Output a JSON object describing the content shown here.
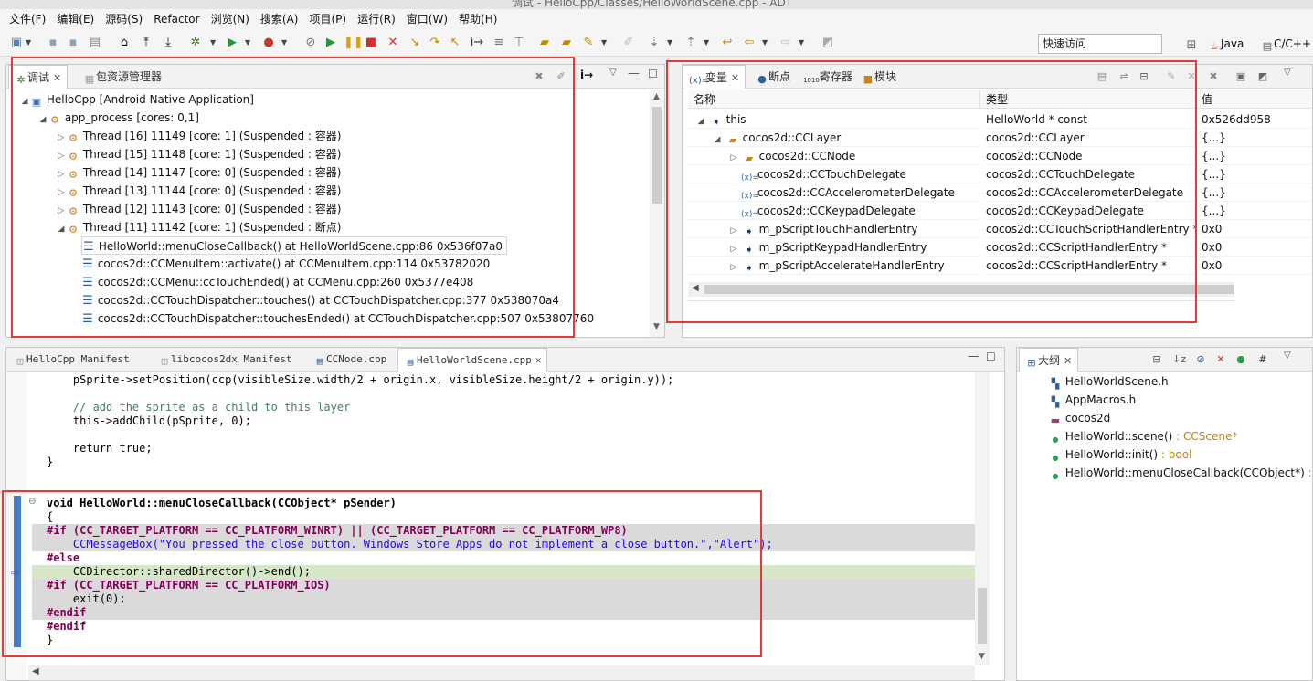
{
  "window": {
    "title": "调试 - HelloCpp/Classes/HelloWorldScene.cpp - ADT"
  },
  "menu": [
    "文件(F)",
    "编辑(E)",
    "源码(S)",
    "Refactor",
    "浏览(N)",
    "搜索(A)",
    "项目(P)",
    "运行(R)",
    "窗口(W)",
    "帮助(H)"
  ],
  "toolbar": {
    "quick_access": "快速访问",
    "persp_java": "Java",
    "persp_cpp": "C/C++"
  },
  "debug_panel": {
    "tabs": [
      "调试",
      "包资源管理器"
    ],
    "tree": [
      {
        "label": "HelloCpp [Android Native Application]"
      },
      {
        "label": "app_process [cores: 0,1]"
      },
      {
        "label": "Thread [16] 11149 [core: 1] (Suspended : 容器)"
      },
      {
        "label": "Thread [15] 11148 [core: 1] (Suspended : 容器)"
      },
      {
        "label": "Thread [14] 11147 [core: 0] (Suspended : 容器)"
      },
      {
        "label": "Thread [13] 11144 [core: 0] (Suspended : 容器)"
      },
      {
        "label": "Thread [12] 11143 [core: 0] (Suspended : 容器)"
      },
      {
        "label": "Thread [11] 11142 [core: 1] (Suspended : 断点)"
      },
      {
        "label": "HelloWorld::menuCloseCallback() at HelloWorldScene.cpp:86 0x536f07a0"
      },
      {
        "label": "cocos2d::CCMenuItem::activate() at CCMenuItem.cpp:114 0x53782020"
      },
      {
        "label": "cocos2d::CCMenu::ccTouchEnded() at CCMenu.cpp:260 0x5377e408"
      },
      {
        "label": "cocos2d::CCTouchDispatcher::touches() at CCTouchDispatcher.cpp:377 0x538070a4"
      },
      {
        "label": "cocos2d::CCTouchDispatcher::touchesEnded() at CCTouchDispatcher.cpp:507 0x53807760"
      }
    ]
  },
  "variables_panel": {
    "tabs": [
      "变量",
      "断点",
      "寄存器",
      "模块"
    ],
    "columns": [
      "名称",
      "类型",
      "值"
    ],
    "rows": [
      {
        "name": "this",
        "type": "HelloWorld * const",
        "value": "0x526dd958"
      },
      {
        "name": "cocos2d::CCLayer",
        "type": "cocos2d::CCLayer",
        "value": "{...}"
      },
      {
        "name": "cocos2d::CCNode",
        "type": "cocos2d::CCNode",
        "value": "{...}"
      },
      {
        "name": "cocos2d::CCTouchDelegate",
        "type": "cocos2d::CCTouchDelegate",
        "value": "{...}"
      },
      {
        "name": "cocos2d::CCAccelerometerDelegate",
        "type": "cocos2d::CCAccelerometerDelegate",
        "value": "{...}"
      },
      {
        "name": "cocos2d::CCKeypadDelegate",
        "type": "cocos2d::CCKeypadDelegate",
        "value": "{...}"
      },
      {
        "name": "m_pScriptTouchHandlerEntry",
        "type": "cocos2d::CCTouchScriptHandlerEntry *",
        "value": "0x0"
      },
      {
        "name": "m_pScriptKeypadHandlerEntry",
        "type": "cocos2d::CCScriptHandlerEntry *",
        "value": "0x0"
      },
      {
        "name": "m_pScriptAccelerateHandlerEntry",
        "type": "cocos2d::CCScriptHandlerEntry *",
        "value": "0x0"
      }
    ]
  },
  "editor": {
    "tabs": [
      "HelloCpp Manifest",
      "libcocos2dx Manifest",
      "CCNode.cpp",
      "HelloWorldScene.cpp"
    ],
    "lines": [
      "    pSprite->setPosition(ccp(visibleSize.width/2 + origin.x, visibleSize.height/2 + origin.y));",
      "",
      "    // add the sprite as a child to this layer",
      "    this->addChild(pSprite, 0);",
      "",
      "    return true;",
      "}",
      "",
      "",
      "void HelloWorld::menuCloseCallback(CCObject* pSender)",
      "{",
      "#if (CC_TARGET_PLATFORM == CC_PLATFORM_WINRT) || (CC_TARGET_PLATFORM == CC_PLATFORM_WP8)",
      "    CCMessageBox(\"You pressed the close button. Windows Store Apps do not implement a close button.\",\"Alert\");",
      "#else",
      "    CCDirector::sharedDirector()->end();",
      "#if (CC_TARGET_PLATFORM == CC_PLATFORM_IOS)",
      "    exit(0);",
      "#endif",
      "#endif",
      "}"
    ]
  },
  "outline_panel": {
    "tab": "大纲",
    "items": [
      {
        "name": "HelloWorldScene.h",
        "type": ""
      },
      {
        "name": "AppMacros.h",
        "type": ""
      },
      {
        "name": "cocos2d",
        "type": ""
      },
      {
        "name": "HelloWorld::scene()",
        "type": " : CCScene*"
      },
      {
        "name": "HelloWorld::init()",
        "type": " : bool"
      },
      {
        "name": "HelloWorld::menuCloseCallback(CCObject*)",
        "type": " :"
      }
    ]
  },
  "colors": {
    "highlight_outline": "#e53935",
    "keyword": "#7f0055",
    "string": "#2a00ff",
    "comment": "#3f7f5f"
  }
}
